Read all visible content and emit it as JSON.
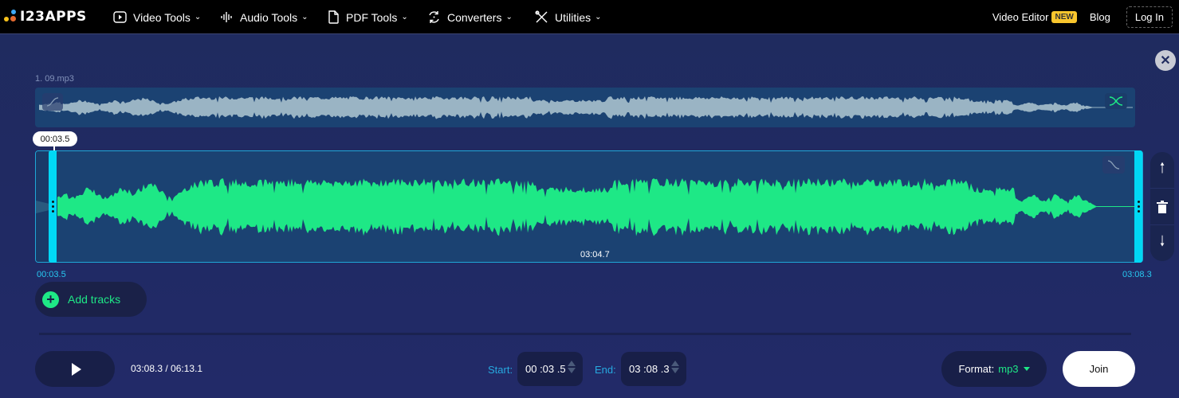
{
  "nav": {
    "logo_text": "I23APPS",
    "items": [
      {
        "label": "Video Tools",
        "icon": "play-square-icon"
      },
      {
        "label": "Audio Tools",
        "icon": "audio-wave-icon"
      },
      {
        "label": "PDF Tools",
        "icon": "document-icon"
      },
      {
        "label": "Converters",
        "icon": "convert-cycle-icon"
      },
      {
        "label": "Utilities",
        "icon": "tools-icon"
      }
    ],
    "video_editor_label": "Video Editor",
    "new_badge": "NEW",
    "blog_label": "Blog",
    "login_label": "Log In"
  },
  "editor": {
    "close_icon": "close-icon",
    "file_name": "1. 09.mp3",
    "selection_start_tooltip": "00:03.5",
    "selection_duration": "03:04.7",
    "start_label": "00:03.5",
    "end_label": "03:08.3",
    "add_tracks_label": "Add tracks",
    "colors": {
      "waveform_active": "#1ee886",
      "waveform_overview": "#9ab4c4",
      "handle": "#00d8f5",
      "track_bg": "#1b4272"
    }
  },
  "player": {
    "time_display": "03:08.3 / 06:13.1",
    "start_caption": "Start:",
    "start_value": "00 :03 .5",
    "end_caption": "End:",
    "end_value": "03 :08 .3"
  },
  "output": {
    "format_label": "Format:",
    "format_value": "mp3",
    "join_label": "Join"
  }
}
